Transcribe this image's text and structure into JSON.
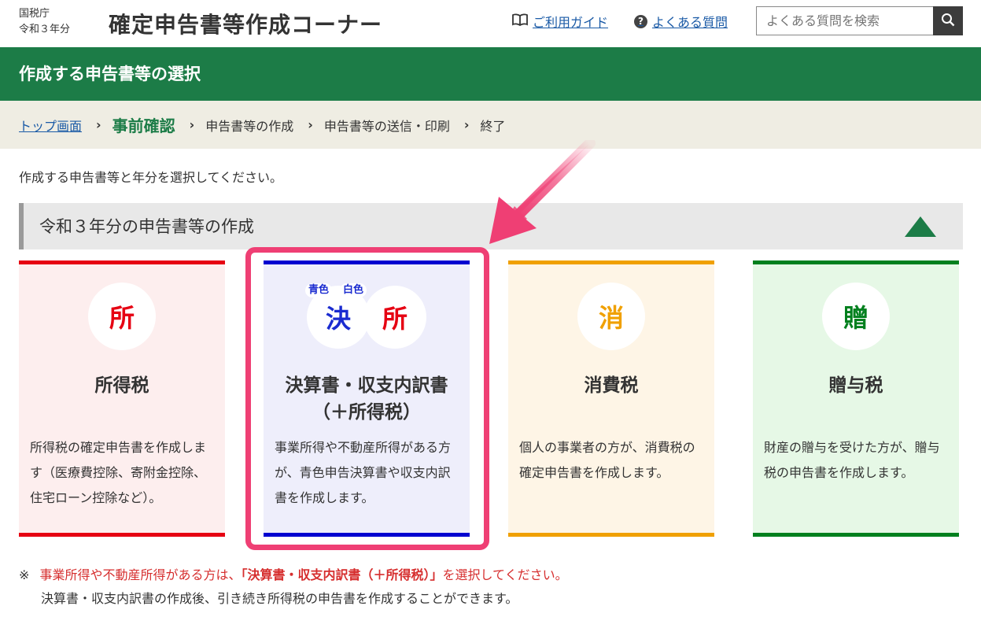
{
  "header": {
    "agency_line1": "国税庁",
    "agency_line2": "令和３年分",
    "app_title": "確定申告書等作成コーナー",
    "guide_link": "ご利用ガイド",
    "faq_link": "よくある質問",
    "search_placeholder": "よくある質問を検索"
  },
  "page": {
    "title": "作成する申告書等の選択",
    "instruction": "作成する申告書等と年分を選択してください。"
  },
  "breadcrumb": {
    "items": [
      "トップ画面",
      "事前確認",
      "申告書等の作成",
      "申告書等の送信・印刷",
      "終了"
    ]
  },
  "section": {
    "title": "令和３年分の申告書等の作成"
  },
  "cards": [
    {
      "icon_char": "所",
      "title": "所得税",
      "description": "所得税の確定申告書を作成します（医療費控除、寄附金控除、住宅ローン控除など）。",
      "accent_color": "#e60012",
      "bg_color": "#fdeeee"
    },
    {
      "icon_char_1": "決",
      "icon_char_2": "所",
      "tag_1": "青色",
      "tag_2": "白色",
      "title_line1": "決算書・収支内訳書",
      "title_line2": "（＋所得税）",
      "description": "事業所得や不動産所得がある方が、青色申告決算書や収支内訳書を作成します。",
      "accent_color": "#0000d0",
      "bg_color": "#eeeefb"
    },
    {
      "icon_char": "消",
      "title": "消費税",
      "description": "個人の事業者の方が、消費税の確定申告書を作成します。",
      "accent_color": "#f0a000",
      "bg_color": "#fef5e6"
    },
    {
      "icon_char": "贈",
      "title": "贈与税",
      "description": "財産の贈与を受けた方が、贈与税の申告書を作成します。",
      "accent_color": "#00801e",
      "bg_color": "#e6f8e6"
    }
  ],
  "notes": {
    "mark": "※",
    "line1_a": "事業所得や不動産所得がある方は、",
    "line1_b": "「決算書・収支内訳書（＋所得税）」",
    "line1_c": "を選択してください。",
    "line2": "決算書・収支内訳書の作成後、引き続き所得税の申告書を作成することができます。"
  },
  "colors": {
    "brand_green": "#1c7c47",
    "highlight_pink": "#ef3f74",
    "link_blue": "#1a5aa6"
  }
}
